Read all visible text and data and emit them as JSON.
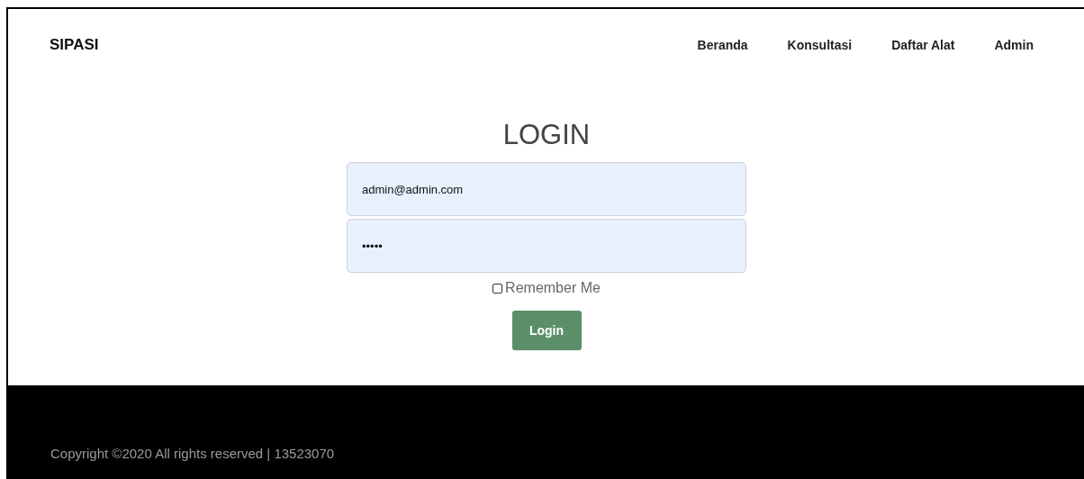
{
  "navbar": {
    "brand": "SIPASI",
    "links": [
      {
        "label": "Beranda"
      },
      {
        "label": "Konsultasi"
      },
      {
        "label": "Daftar Alat"
      },
      {
        "label": "Admin"
      }
    ]
  },
  "login": {
    "title": "LOGIN",
    "email": {
      "value": "admin@admin.com"
    },
    "password": {
      "value": "•••••"
    },
    "remember": {
      "label": "Remember Me",
      "checked": false
    },
    "button": "Login"
  },
  "footer": {
    "text": "Copyright ©2020 All rights reserved | 13523070"
  }
}
